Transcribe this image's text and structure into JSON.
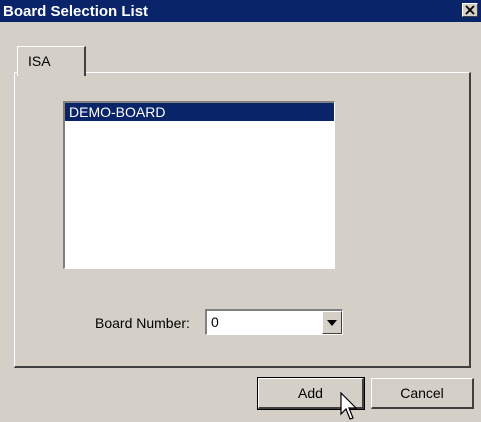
{
  "window": {
    "title": "Board Selection List",
    "close_label": "close"
  },
  "tabs": [
    {
      "label": "ISA",
      "active": true
    }
  ],
  "board_list": {
    "items": [
      {
        "label": "DEMO-BOARD",
        "selected": true
      }
    ]
  },
  "board_number": {
    "label": "Board Number:",
    "value": "0"
  },
  "buttons": {
    "add_label": "Add",
    "cancel_label": "Cancel"
  },
  "colors": {
    "titlebar": "#0a246a",
    "selection": "#0a246a",
    "dialog_face": "#d4d0c8"
  },
  "icons": {
    "close": "close-icon",
    "dropdown": "chevron-down-icon",
    "cursor": "mouse-pointer-icon"
  }
}
